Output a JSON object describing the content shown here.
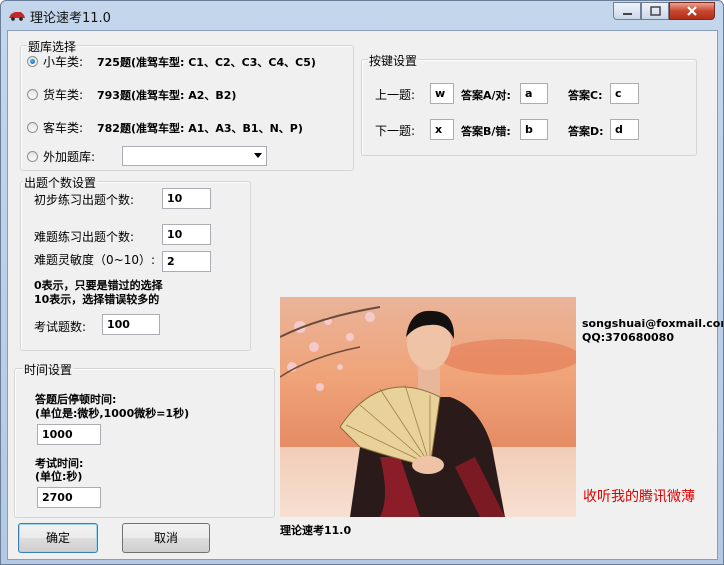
{
  "window": {
    "title": "理论速考11.0"
  },
  "bank": {
    "legend": "题库选择",
    "options": [
      {
        "label": "小车类:",
        "desc": "725题(准驾车型: C1、C2、C3、C4、C5)",
        "selected": true
      },
      {
        "label": "货车类:",
        "desc": "793题(准驾车型: A2、B2)",
        "selected": false
      },
      {
        "label": "客车类:",
        "desc": "782题(准驾车型: A1、A3、B1、N、P)",
        "selected": false
      },
      {
        "label": "外加题库:",
        "desc": "",
        "selected": false
      }
    ],
    "extra_value": ""
  },
  "keys": {
    "legend": "按键设置",
    "prev_label": "上一题:",
    "prev_value": "w",
    "next_label": "下一题:",
    "next_value": "x",
    "a_label": "答案A/对:",
    "a_value": "a",
    "b_label": "答案B/错:",
    "b_value": "b",
    "c_label": "答案C:",
    "c_value": "c",
    "d_label": "答案D:",
    "d_value": "d"
  },
  "count": {
    "legend": "出题个数设置",
    "initial_label": "初步练习出题个数:",
    "initial_value": "10",
    "hard_label": "难题练习出题个数:",
    "hard_value": "10",
    "sens_label": "难题灵敏度（0~10）:",
    "sens_value": "2",
    "note1": "0表示，只要是错过的选择",
    "note2": "10表示，选择错误较多的",
    "exam_label": "考试题数:",
    "exam_value": "100"
  },
  "time": {
    "legend": "时间设置",
    "pause_label1": "答题后停顿时间:",
    "pause_label2": "(单位是:微秒,1000微秒=1秒)",
    "pause_value": "1000",
    "exam_label1": "考试时间:",
    "exam_label2": "(单位:秒)",
    "exam_value": "2700"
  },
  "buttons": {
    "ok": "确定",
    "cancel": "取消"
  },
  "contact": {
    "email": "songshuai@foxmail.com",
    "qq": "QQ:370680080"
  },
  "weibo": {
    "text": "收听我的腾讯微薄",
    "color": "#e00000"
  },
  "version": "理论速考11.0"
}
